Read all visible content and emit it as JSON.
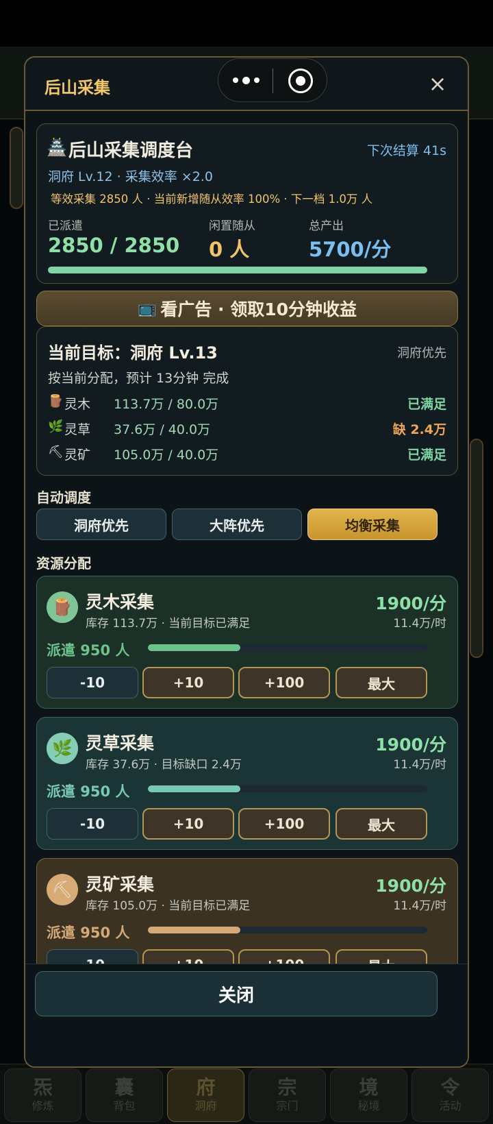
{
  "modal": {
    "title": "后山采集",
    "close_glyph": "×",
    "footer_close_label": "关闭"
  },
  "dispatch": {
    "heading": "后山采集调度台",
    "heading_icon": "temple-icon",
    "next_settle": "下次结算 41s",
    "level_line": "洞府 Lv.12 · 采集效率 ×2.0",
    "info_line": "等效采集 2850 人 · 当前新增随从效率 100% · 下一档 1.0万 人",
    "dispatched_label": "已派遣",
    "dispatched_value": "2850 / 2850",
    "idle_label": "闲置随从",
    "idle_value": "0 人",
    "output_label": "总产出",
    "output_value": "5700/分",
    "progress": 1.0
  },
  "ad_button": {
    "label": "看广告 · 领取10分钟收益",
    "icon": "tv-icon"
  },
  "target": {
    "title": "当前目标：洞府 Lv.13",
    "priority": "洞府优先",
    "estimate": "按当前分配，预计 13分钟 完成",
    "rows": [
      {
        "icon": "wood-icon",
        "name": "灵木",
        "amount": "113.7万 / 80.0万",
        "status": "已满足",
        "status_color": "#7fd6a4"
      },
      {
        "icon": "herb-icon",
        "name": "灵草",
        "amount": "37.6万 / 40.0万",
        "status": "缺 2.4万",
        "status_color": "#f0a657"
      },
      {
        "icon": "pickaxe-icon",
        "name": "灵矿",
        "amount": "105.0万 / 40.0万",
        "status": "已满足",
        "status_color": "#7fd6a4"
      }
    ]
  },
  "auto": {
    "label": "自动调度",
    "options": [
      "洞府优先",
      "大阵优先",
      "均衡采集"
    ],
    "selected": "均衡采集"
  },
  "allocation": {
    "label": "资源分配",
    "cards": [
      {
        "icon": "wood-icon",
        "title": "灵木采集",
        "stock": "库存 113.7万 · 当前目标已满足",
        "rate": "1900/分",
        "hourly": "11.4万/时",
        "dispatch": "派遣 950 人",
        "fill": 0.33,
        "bg": "#1b3128",
        "accent": "#6cc18c"
      },
      {
        "icon": "herb-icon",
        "title": "灵草采集",
        "stock": "库存 37.6万 · 目标缺口 2.4万",
        "rate": "1900/分",
        "hourly": "11.4万/时",
        "dispatch": "派遣 950 人",
        "fill": 0.33,
        "bg": "#1b3537",
        "accent": "#78c9b4"
      },
      {
        "icon": "pickaxe-icon",
        "title": "灵矿采集",
        "stock": "库存 105.0万 · 当前目标已满足",
        "rate": "1900/分",
        "hourly": "11.4万/时",
        "dispatch": "派遣 950 人",
        "fill": 0.33,
        "bg": "#3b3222",
        "accent": "#d4a877"
      }
    ],
    "buttons": [
      "-10",
      "+10",
      "+100",
      "最大"
    ]
  },
  "bottom_nav": [
    {
      "glyph": "炁",
      "label": "修炼"
    },
    {
      "glyph": "囊",
      "label": "背包"
    },
    {
      "glyph": "府",
      "label": "洞府"
    },
    {
      "glyph": "宗",
      "label": "宗门"
    },
    {
      "glyph": "境",
      "label": "秘境"
    },
    {
      "glyph": "令",
      "label": "活动"
    }
  ],
  "colors": {
    "gold": "#f0c36a",
    "green": "#7fd6a4",
    "blue": "#7bbff0",
    "orange": "#f0a657"
  }
}
